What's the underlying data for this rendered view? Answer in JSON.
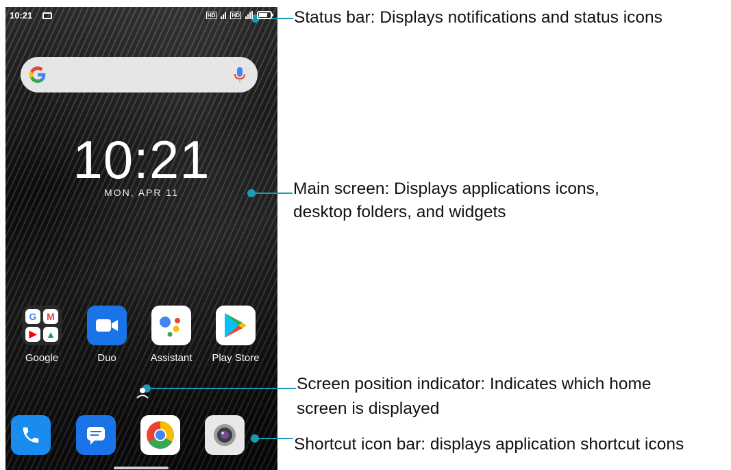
{
  "status_bar": {
    "time": "10:21"
  },
  "search": {
    "logo": "google-g-icon",
    "mic": "mic-icon"
  },
  "clock": {
    "time": "10:21",
    "date": "MON, APR 11"
  },
  "apps": [
    {
      "label": "Google"
    },
    {
      "label": "Duo"
    },
    {
      "label": "Assistant"
    },
    {
      "label": "Play Store"
    }
  ],
  "folder_icons": [
    "G",
    "M",
    "▶",
    "▲"
  ],
  "dock": [
    "phone-icon",
    "messages-icon",
    "chrome-icon",
    "camera-icon"
  ],
  "annotations": {
    "status_bar": "Status bar:  Displays notifications and status icons",
    "main_screen_line1": "Main screen: Displays applications icons,",
    "main_screen_line2": "desktop folders, and widgets",
    "indicator_line1": "Screen position indicator: Indicates which home",
    "indicator_line2": "screen is displayed",
    "shortcut_bar": "Shortcut icon bar: displays application shortcut icons"
  },
  "colors": {
    "accent": "#1a9bb7",
    "duo": "#1b73e8"
  }
}
